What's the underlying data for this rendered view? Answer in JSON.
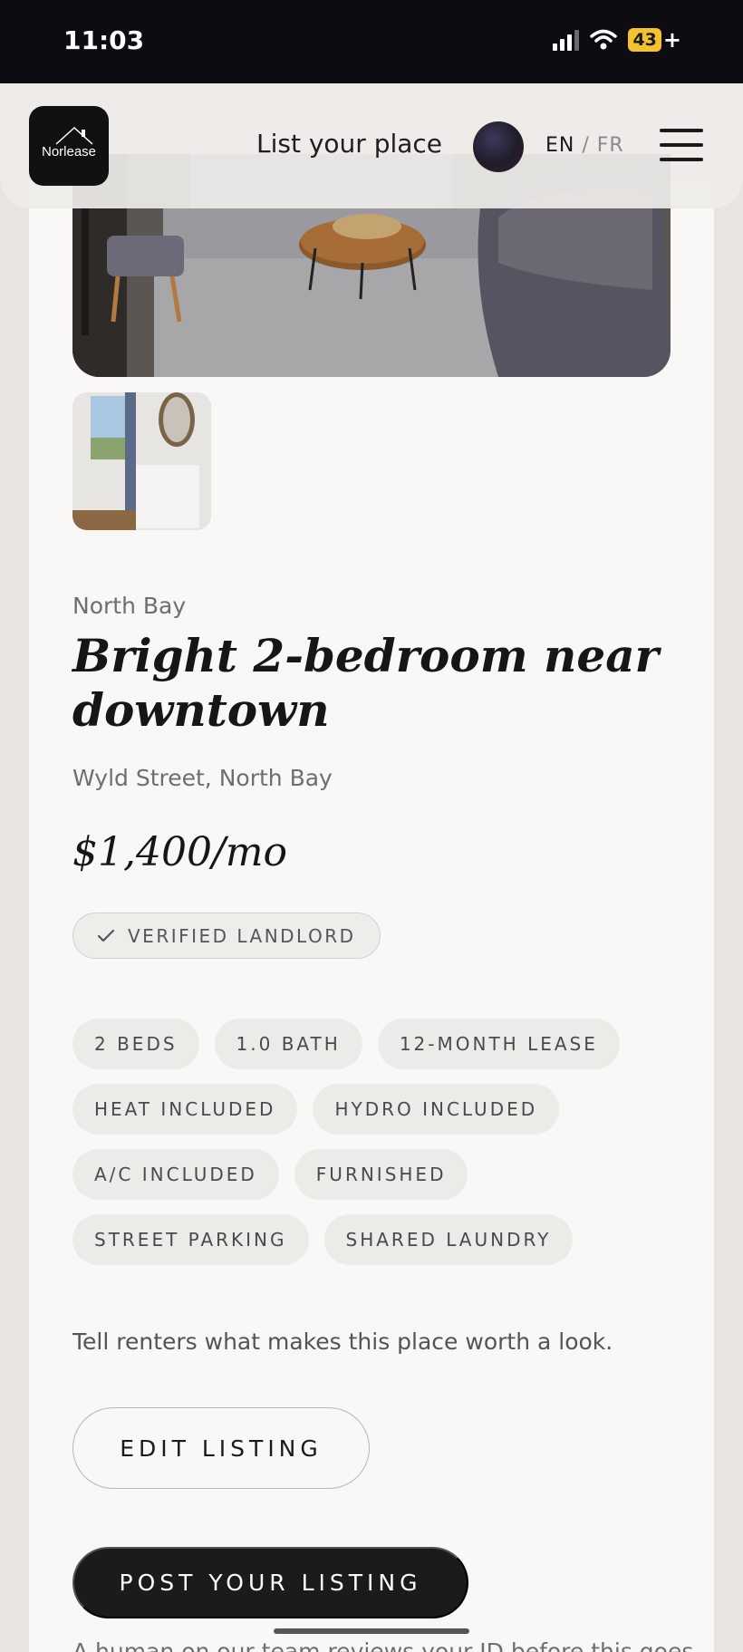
{
  "status_bar": {
    "time": "11:03",
    "battery": "43"
  },
  "header": {
    "logo": {
      "text": "Norlease"
    },
    "list_place_link": "List your place",
    "language": {
      "en": "EN",
      "separator": "/",
      "fr": "FR"
    }
  },
  "listing": {
    "location": "North Bay",
    "title": "Bright 2-bedroom near downtown",
    "address": "Wyld Street, North Bay",
    "price": "$1,400/mo",
    "verified_badge": "VERIFIED LANDLORD",
    "features": [
      "2 BEDS",
      "1.0 BATH",
      "12-MONTH LEASE",
      "HEAT INCLUDED",
      "HYDRO INCLUDED",
      "A/C INCLUDED",
      "FURNISHED",
      "STREET PARKING",
      "SHARED LAUNDRY"
    ],
    "description_placeholder": "Tell renters what makes this place worth a look."
  },
  "actions": {
    "edit_label": "EDIT LISTING",
    "post_label": "POST YOUR LISTING"
  },
  "footer_note": "A human on our team reviews your ID before this goes"
}
